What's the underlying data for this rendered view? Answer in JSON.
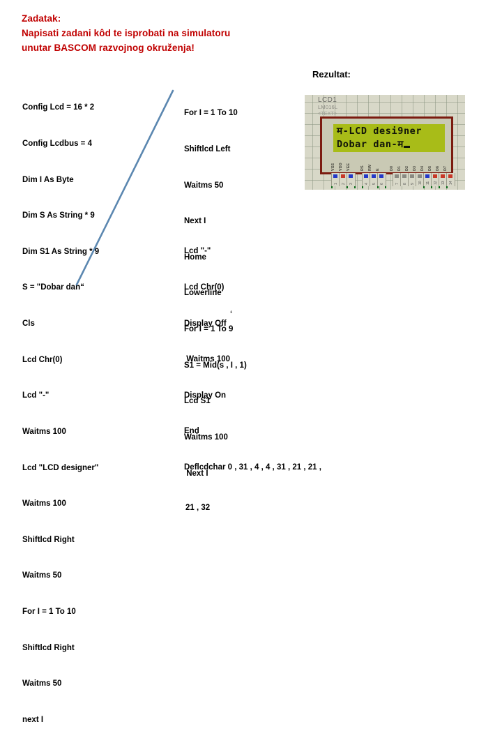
{
  "header": {
    "lines": [
      "Zadatak:",
      "Napisati zadani kôd te isprobati na simulatoru",
      "unutar BASCOM razvojnog okruženja!"
    ],
    "color": "#C00000"
  },
  "code_left": {
    "lines": [
      "Config Lcd = 16 * 2",
      "Config Lcdbus = 4",
      "Dim I As Byte",
      "Dim S As String * 9",
      "Dim S1 As String * 9",
      "S = \"Dobar dan“",
      "Cls",
      "Lcd Chr(0)",
      "Lcd \"-\"",
      "Waitms 100",
      "Lcd \"LCD designer\"",
      "Waitms 100",
      "Shiftlcd Right",
      "Waitms 50",
      "For I = 1 To 10",
      "Shiftlcd Right",
      "Waitms 50",
      "next I"
    ]
  },
  "code_mid": {
    "lines": [
      "For I = 1 To 10",
      "Shiftlcd Left",
      "Waitms 50",
      "Next I",
      "Home",
      "Lowerline",
      "For I = 1 To 9",
      "S1 = Mid(s , I , 1)",
      "Lcd S1",
      "Waitms 100",
      " Next I"
    ]
  },
  "code_mid_2": {
    "lines": [
      "Lcd \"-\"",
      "Lcd Chr(0)",
      "Display Off",
      " Waitms 100",
      "Display On",
      "End",
      "Deflcdchar 0 , 31 , 4 , 4 , 31 , 21 , 21 ,"
    ],
    "last_line": "21 , 32",
    "tick_mark": "‘"
  },
  "result": {
    "label": "Rezultat:"
  },
  "lcd": {
    "component_id": "LCD1",
    "component_model": "LM016L",
    "component_text": "<TEXT>",
    "screen_line1": "म-LCD desi9ner",
    "screen_line2": "Dobar dan-म",
    "screen_color": "#A8BC18",
    "bezel_color": "#7B1B10",
    "pin_labels": [
      "VSS",
      "VDD",
      "VEE",
      "RS",
      "RW",
      "E",
      "D0",
      "D1",
      "D2",
      "D3",
      "D4",
      "D5",
      "D6",
      "D7"
    ],
    "pin_numbers": [
      "1",
      "2",
      "3",
      "4",
      "5",
      "6",
      "7",
      "8",
      "9",
      "10",
      "11",
      "12",
      "13",
      "14"
    ]
  }
}
